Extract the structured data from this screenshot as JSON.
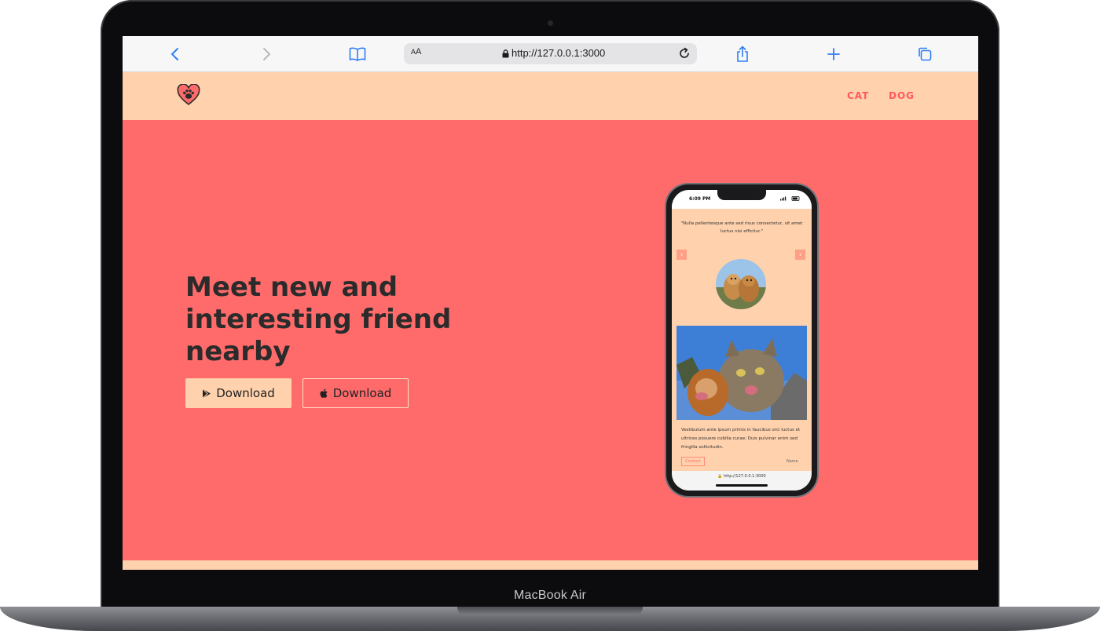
{
  "device": {
    "label": "MacBook Air"
  },
  "browser": {
    "reader_label_big": "A",
    "reader_label_small": "A",
    "url": "http://127.0.0.1:3000"
  },
  "site": {
    "nav": [
      {
        "label": "CAT"
      },
      {
        "label": "DOG"
      }
    ],
    "hero": {
      "title": "Meet new and interesting friend nearby",
      "google_button": "Download",
      "apple_button": "Download"
    }
  },
  "phone": {
    "time": "6:09 PM",
    "quote": "\"Nulla pellentesque ante sed risus consectetur, sit amet luctus nisi efficitur.\"",
    "body": "Vestibulum ante ipsum primis in faucibus orci luctus et ultrices posuere cubilia curae; Duis pulvinar enim sed fringilla sollicitudin.",
    "contact": "Contact",
    "name": "Name",
    "url": "http://127.0.0.1:3000"
  },
  "colors": {
    "hero_bg": "#ff6b6b",
    "header_bg": "#ffd1ac",
    "accent": "#ff5a5a",
    "text_dark": "#2b2b2b"
  }
}
